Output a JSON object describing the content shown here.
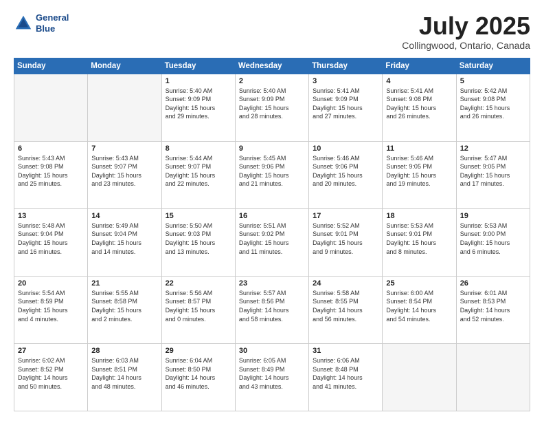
{
  "header": {
    "logo_line1": "General",
    "logo_line2": "Blue",
    "month_year": "July 2025",
    "location": "Collingwood, Ontario, Canada"
  },
  "days_of_week": [
    "Sunday",
    "Monday",
    "Tuesday",
    "Wednesday",
    "Thursday",
    "Friday",
    "Saturday"
  ],
  "weeks": [
    [
      {
        "day": "",
        "info": ""
      },
      {
        "day": "",
        "info": ""
      },
      {
        "day": "1",
        "info": "Sunrise: 5:40 AM\nSunset: 9:09 PM\nDaylight: 15 hours\nand 29 minutes."
      },
      {
        "day": "2",
        "info": "Sunrise: 5:40 AM\nSunset: 9:09 PM\nDaylight: 15 hours\nand 28 minutes."
      },
      {
        "day": "3",
        "info": "Sunrise: 5:41 AM\nSunset: 9:09 PM\nDaylight: 15 hours\nand 27 minutes."
      },
      {
        "day": "4",
        "info": "Sunrise: 5:41 AM\nSunset: 9:08 PM\nDaylight: 15 hours\nand 26 minutes."
      },
      {
        "day": "5",
        "info": "Sunrise: 5:42 AM\nSunset: 9:08 PM\nDaylight: 15 hours\nand 26 minutes."
      }
    ],
    [
      {
        "day": "6",
        "info": "Sunrise: 5:43 AM\nSunset: 9:08 PM\nDaylight: 15 hours\nand 25 minutes."
      },
      {
        "day": "7",
        "info": "Sunrise: 5:43 AM\nSunset: 9:07 PM\nDaylight: 15 hours\nand 23 minutes."
      },
      {
        "day": "8",
        "info": "Sunrise: 5:44 AM\nSunset: 9:07 PM\nDaylight: 15 hours\nand 22 minutes."
      },
      {
        "day": "9",
        "info": "Sunrise: 5:45 AM\nSunset: 9:06 PM\nDaylight: 15 hours\nand 21 minutes."
      },
      {
        "day": "10",
        "info": "Sunrise: 5:46 AM\nSunset: 9:06 PM\nDaylight: 15 hours\nand 20 minutes."
      },
      {
        "day": "11",
        "info": "Sunrise: 5:46 AM\nSunset: 9:05 PM\nDaylight: 15 hours\nand 19 minutes."
      },
      {
        "day": "12",
        "info": "Sunrise: 5:47 AM\nSunset: 9:05 PM\nDaylight: 15 hours\nand 17 minutes."
      }
    ],
    [
      {
        "day": "13",
        "info": "Sunrise: 5:48 AM\nSunset: 9:04 PM\nDaylight: 15 hours\nand 16 minutes."
      },
      {
        "day": "14",
        "info": "Sunrise: 5:49 AM\nSunset: 9:04 PM\nDaylight: 15 hours\nand 14 minutes."
      },
      {
        "day": "15",
        "info": "Sunrise: 5:50 AM\nSunset: 9:03 PM\nDaylight: 15 hours\nand 13 minutes."
      },
      {
        "day": "16",
        "info": "Sunrise: 5:51 AM\nSunset: 9:02 PM\nDaylight: 15 hours\nand 11 minutes."
      },
      {
        "day": "17",
        "info": "Sunrise: 5:52 AM\nSunset: 9:01 PM\nDaylight: 15 hours\nand 9 minutes."
      },
      {
        "day": "18",
        "info": "Sunrise: 5:53 AM\nSunset: 9:01 PM\nDaylight: 15 hours\nand 8 minutes."
      },
      {
        "day": "19",
        "info": "Sunrise: 5:53 AM\nSunset: 9:00 PM\nDaylight: 15 hours\nand 6 minutes."
      }
    ],
    [
      {
        "day": "20",
        "info": "Sunrise: 5:54 AM\nSunset: 8:59 PM\nDaylight: 15 hours\nand 4 minutes."
      },
      {
        "day": "21",
        "info": "Sunrise: 5:55 AM\nSunset: 8:58 PM\nDaylight: 15 hours\nand 2 minutes."
      },
      {
        "day": "22",
        "info": "Sunrise: 5:56 AM\nSunset: 8:57 PM\nDaylight: 15 hours\nand 0 minutes."
      },
      {
        "day": "23",
        "info": "Sunrise: 5:57 AM\nSunset: 8:56 PM\nDaylight: 14 hours\nand 58 minutes."
      },
      {
        "day": "24",
        "info": "Sunrise: 5:58 AM\nSunset: 8:55 PM\nDaylight: 14 hours\nand 56 minutes."
      },
      {
        "day": "25",
        "info": "Sunrise: 6:00 AM\nSunset: 8:54 PM\nDaylight: 14 hours\nand 54 minutes."
      },
      {
        "day": "26",
        "info": "Sunrise: 6:01 AM\nSunset: 8:53 PM\nDaylight: 14 hours\nand 52 minutes."
      }
    ],
    [
      {
        "day": "27",
        "info": "Sunrise: 6:02 AM\nSunset: 8:52 PM\nDaylight: 14 hours\nand 50 minutes."
      },
      {
        "day": "28",
        "info": "Sunrise: 6:03 AM\nSunset: 8:51 PM\nDaylight: 14 hours\nand 48 minutes."
      },
      {
        "day": "29",
        "info": "Sunrise: 6:04 AM\nSunset: 8:50 PM\nDaylight: 14 hours\nand 46 minutes."
      },
      {
        "day": "30",
        "info": "Sunrise: 6:05 AM\nSunset: 8:49 PM\nDaylight: 14 hours\nand 43 minutes."
      },
      {
        "day": "31",
        "info": "Sunrise: 6:06 AM\nSunset: 8:48 PM\nDaylight: 14 hours\nand 41 minutes."
      },
      {
        "day": "",
        "info": ""
      },
      {
        "day": "",
        "info": ""
      }
    ]
  ]
}
